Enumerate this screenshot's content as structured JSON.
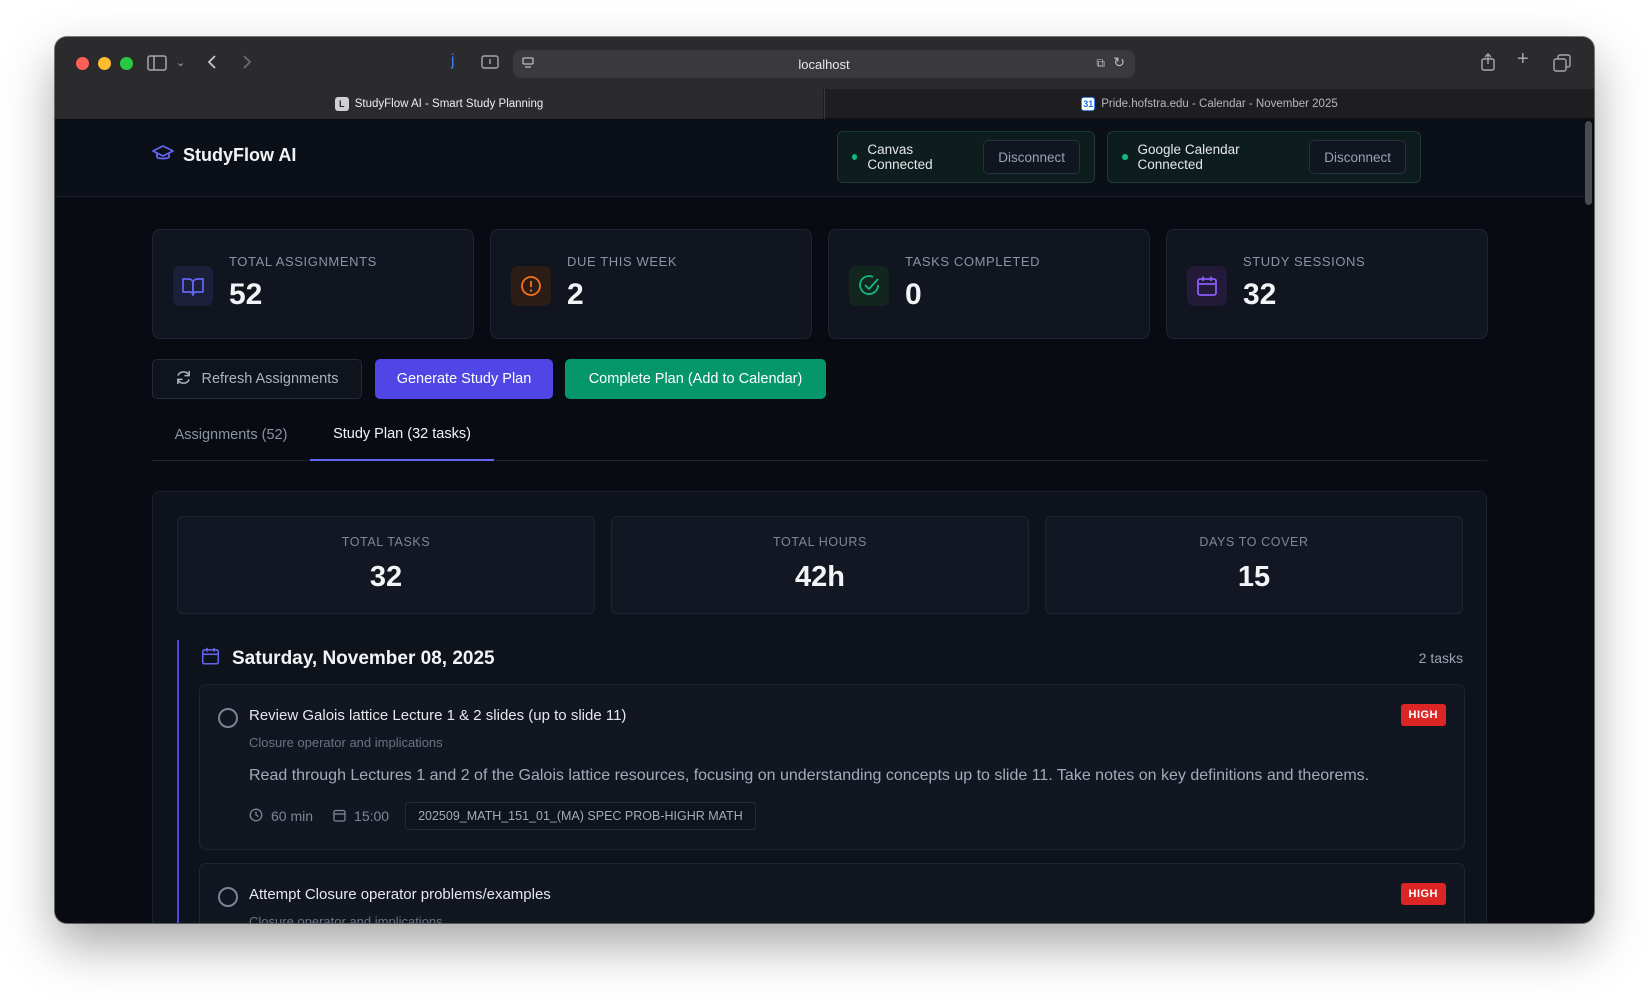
{
  "browser": {
    "url": "localhost",
    "tabs": [
      {
        "label": "StudyFlow AI - Smart Study Planning",
        "favicon": "L"
      },
      {
        "label": "Pride.hofstra.edu - Calendar - November 2025",
        "favicon": "31"
      }
    ]
  },
  "app": {
    "brand": "StudyFlow AI",
    "canvas": {
      "label": "Canvas Connected",
      "button": "Disconnect"
    },
    "gcal": {
      "label": "Google Calendar Connected",
      "button": "Disconnect"
    }
  },
  "stats": [
    {
      "label": "TOTAL ASSIGNMENTS",
      "value": "52",
      "icon": "book-icon",
      "color": "#6366f1"
    },
    {
      "label": "DUE THIS WEEK",
      "value": "2",
      "icon": "alert-circle-icon",
      "color": "#f97316"
    },
    {
      "label": "TASKS COMPLETED",
      "value": "0",
      "icon": "check-circle-icon",
      "color": "#10b981"
    },
    {
      "label": "STUDY SESSIONS",
      "value": "32",
      "icon": "calendar-icon",
      "color": "#8b5cf6"
    }
  ],
  "actions": {
    "refresh": "Refresh Assignments",
    "generate": "Generate Study Plan",
    "complete": "Complete Plan (Add to Calendar)"
  },
  "tabs": {
    "assignments": "Assignments (52)",
    "plan": "Study Plan (32 tasks)"
  },
  "summary": [
    {
      "label": "TOTAL TASKS",
      "value": "32"
    },
    {
      "label": "TOTAL HOURS",
      "value": "42h"
    },
    {
      "label": "DAYS TO COVER",
      "value": "15"
    }
  ],
  "day": {
    "title": "Saturday, November 08, 2025",
    "count": "2 tasks",
    "tasks": [
      {
        "title": "Review Galois lattice Lecture 1 & 2 slides (up to slide 11)",
        "subtitle": "Closure operator and implications",
        "description": "Read through Lectures 1 and 2 of the Galois lattice resources, focusing on understanding concepts up to slide 11. Take notes on key definitions and theorems.",
        "duration": "60 min",
        "time": "15:00",
        "course": "202509_MATH_151_01_(MA) SPEC PROB-HIGHR MATH",
        "priority": "HIGH"
      },
      {
        "title": "Attempt Closure operator problems/examples",
        "subtitle": "Closure operator and implications",
        "priority": "HIGH"
      }
    ]
  },
  "colors": {
    "accent": "#4f46e5",
    "success": "#059669",
    "danger": "#dc2626",
    "background": "#080b12"
  }
}
